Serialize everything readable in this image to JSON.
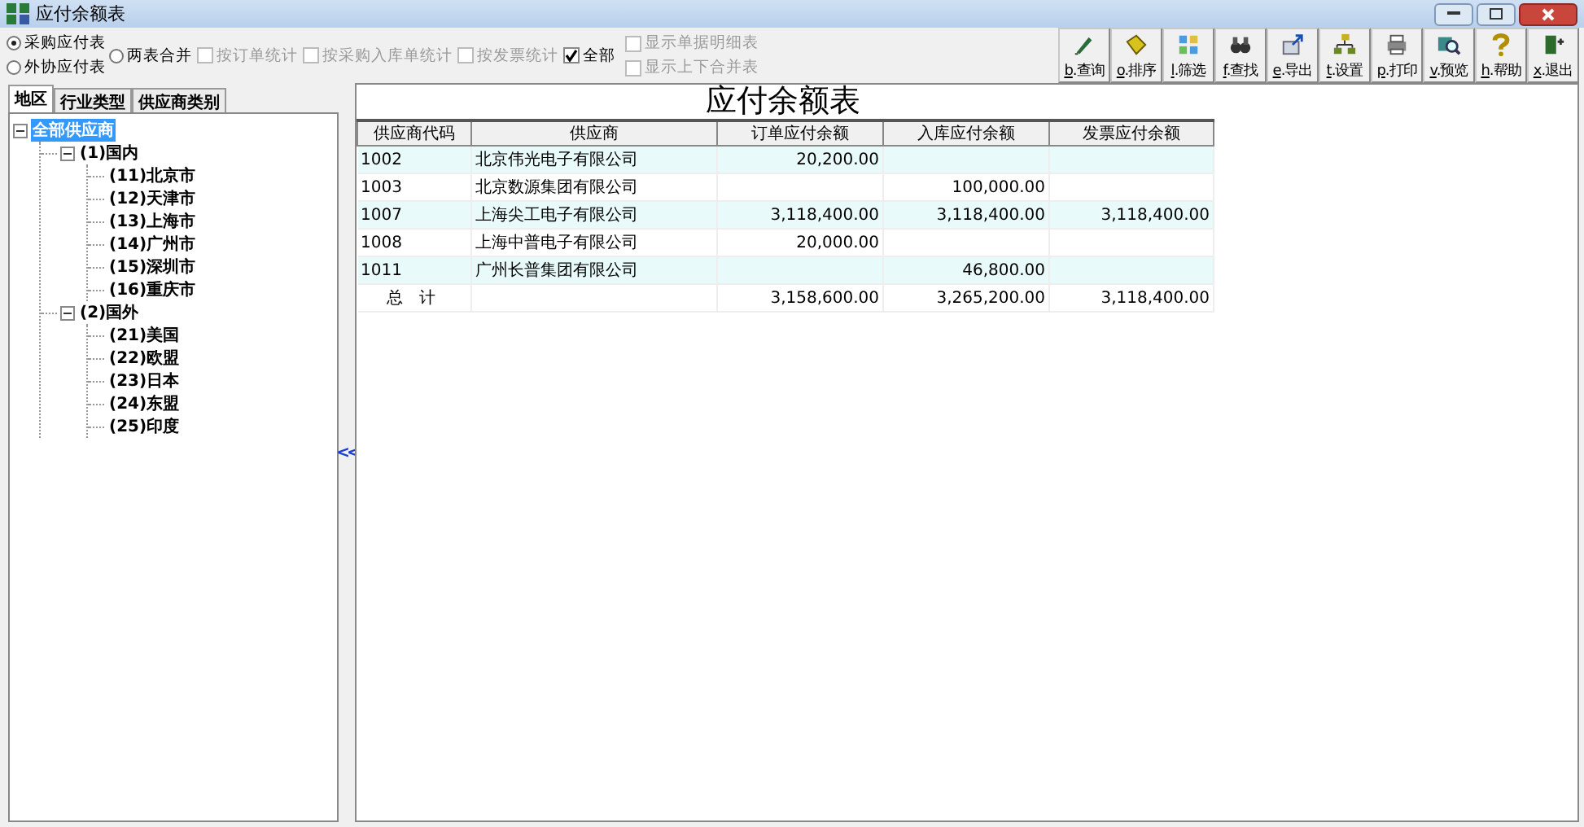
{
  "window": {
    "title": "应付余额表"
  },
  "options": {
    "radios": [
      {
        "label": "采购应付表",
        "selected": true
      },
      {
        "label": "外协应付表",
        "selected": false
      },
      {
        "label": "两表合并",
        "selected": false
      }
    ],
    "checks": [
      {
        "label": "按订单统计",
        "checked": false,
        "disabled": true
      },
      {
        "label": "按采购入库单统计",
        "checked": false,
        "disabled": true
      },
      {
        "label": "按发票统计",
        "checked": false,
        "disabled": true
      },
      {
        "label": "全部",
        "checked": true,
        "disabled": false
      }
    ],
    "display_checks": [
      {
        "label": "显示单据明细表",
        "checked": false,
        "disabled": true
      },
      {
        "label": "显示上下合并表",
        "checked": false,
        "disabled": true
      }
    ]
  },
  "toolbar": [
    {
      "key": "b",
      "label": ".查询"
    },
    {
      "key": "o",
      "label": ".排序"
    },
    {
      "key": "l",
      "label": ".筛选"
    },
    {
      "key": "f",
      "label": ".查找"
    },
    {
      "key": "e",
      "label": ".导出"
    },
    {
      "key": "t",
      "label": ".设置"
    },
    {
      "key": "p",
      "label": ".打印"
    },
    {
      "key": "v",
      "label": ".预览"
    },
    {
      "key": "h",
      "label": ".帮助"
    },
    {
      "key": "x",
      "label": ".退出"
    }
  ],
  "tabs": [
    {
      "label": "地区",
      "selected": true
    },
    {
      "label": "行业类型",
      "selected": false
    },
    {
      "label": "供应商类别",
      "selected": false
    }
  ],
  "tree": [
    {
      "label": "全部供应商",
      "selected": true,
      "expanded": true,
      "children": [
        {
          "label": "(1)国内",
          "selected": false,
          "expanded": true,
          "children": [
            {
              "label": "(11)北京市",
              "selected": false
            },
            {
              "label": "(12)天津市",
              "selected": false
            },
            {
              "label": "(13)上海市",
              "selected": false
            },
            {
              "label": "(14)广州市",
              "selected": false
            },
            {
              "label": "(15)深圳市",
              "selected": false
            },
            {
              "label": "(16)重庆市",
              "selected": false
            }
          ]
        },
        {
          "label": "(2)国外",
          "selected": false,
          "expanded": true,
          "children": [
            {
              "label": "(21)美国",
              "selected": false
            },
            {
              "label": "(22)欧盟",
              "selected": false
            },
            {
              "label": "(23)日本",
              "selected": false
            },
            {
              "label": "(24)东盟",
              "selected": false
            },
            {
              "label": "(25)印度",
              "selected": false
            }
          ]
        }
      ]
    }
  ],
  "splitter": {
    "label": "<<"
  },
  "report": {
    "title": "应付余额表",
    "columns": [
      "供应商代码",
      "供应商",
      "订单应付余额",
      "入库应付余额",
      "发票应付余额"
    ],
    "rows": [
      [
        "1002",
        "北京伟光电子有限公司",
        "20,200.00",
        null,
        null
      ],
      [
        "1003",
        "北京数源集团有限公司",
        null,
        "100,000.00",
        null
      ],
      [
        "1007",
        "上海尖工电子有限公司",
        "3,118,400.00",
        "3,118,400.00",
        "3,118,400.00"
      ],
      [
        "1008",
        "上海中普电子有限公司",
        "20,000.00",
        null,
        null
      ],
      [
        "1011",
        "广州长普集团有限公司",
        null,
        "46,800.00",
        null
      ]
    ],
    "total": {
      "label": "总　计",
      "amounts": [
        "3,158,600.00",
        "3,265,200.00",
        "3,118,400.00"
      ]
    }
  }
}
